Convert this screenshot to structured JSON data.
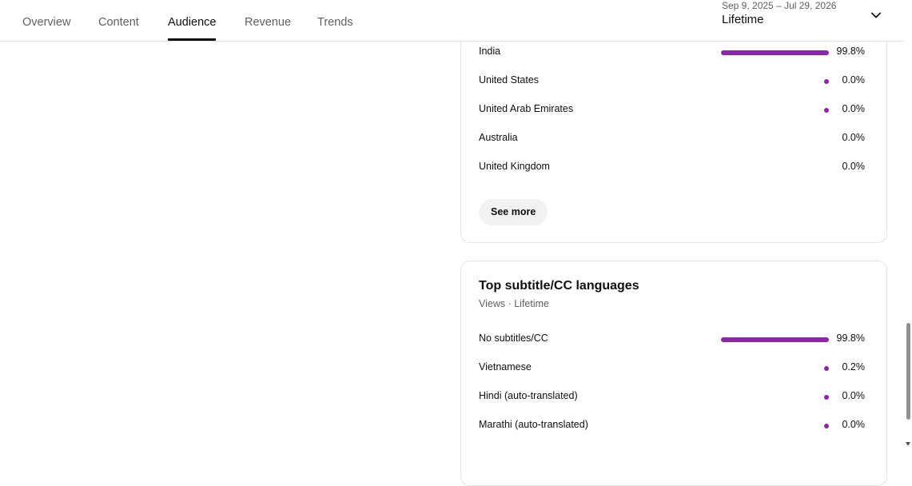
{
  "tabs": [
    {
      "label": "Overview",
      "active": false
    },
    {
      "label": "Content",
      "active": false
    },
    {
      "label": "Audience",
      "active": true
    },
    {
      "label": "Revenue",
      "active": false
    },
    {
      "label": "Trends",
      "active": false
    }
  ],
  "date_range": {
    "range_text": "Sep 9, 2025 – Jul 29, 2026",
    "preset": "Lifetime",
    "icon": "chevron-down-icon"
  },
  "geography_card": {
    "rows": [
      {
        "label": "India",
        "value": "99.8%",
        "share": 99.8
      },
      {
        "label": "United States",
        "value": "0.0%",
        "share": 0.04
      },
      {
        "label": "United Arab Emirates",
        "value": "0.0%",
        "share": 0.04
      },
      {
        "label": "Australia",
        "value": "0.0%",
        "share": 0
      },
      {
        "label": "United Kingdom",
        "value": "0.0%",
        "share": 0
      }
    ],
    "see_more_label": "See more"
  },
  "subtitle_card": {
    "title": "Top subtitle/CC languages",
    "subtitle": "Views · Lifetime",
    "rows": [
      {
        "label": "No subtitles/CC",
        "value": "99.8%",
        "share": 99.8
      },
      {
        "label": "Vietnamese",
        "value": "0.2%",
        "share": 0.2
      },
      {
        "label": "Hindi (auto-translated)",
        "value": "0.0%",
        "share": 0.04
      },
      {
        "label": "Marathi (auto-translated)",
        "value": "0.0%",
        "share": 0.04
      }
    ]
  },
  "colors": {
    "bar": "#8e24aa",
    "text": "#0f0f0f",
    "secondary_text": "#606060",
    "border": "#e5e5e5"
  }
}
